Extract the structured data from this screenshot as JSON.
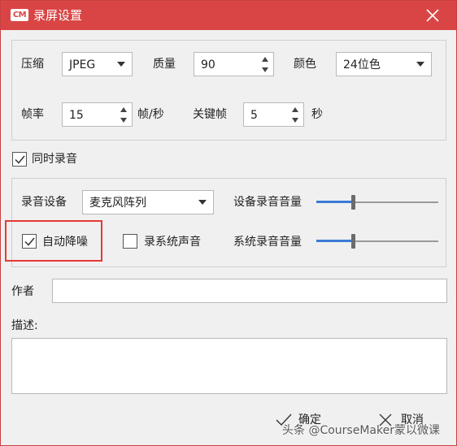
{
  "window": {
    "logo_text": "CM",
    "title": "录屏设置",
    "colors": {
      "titlebar": "#d94545",
      "highlight": "#e53935",
      "accent": "#3a7bd5"
    }
  },
  "video": {
    "compress_label": "压缩",
    "compress_value": "JPEG",
    "quality_label": "质量",
    "quality_value": "90",
    "color_label": "颜色",
    "color_value": "24位色",
    "framerate_label": "帧率",
    "framerate_value": "15",
    "framerate_unit": "帧/秒",
    "keyframe_label": "关键帧",
    "keyframe_value": "5",
    "keyframe_unit": "秒"
  },
  "audio": {
    "record_audio_label": "同时录音",
    "record_audio_checked": true,
    "device_label": "录音设备",
    "device_value": "麦克风阵列",
    "device_volume_label": "设备录音音量",
    "device_volume_level": 0.3,
    "denoise_label": "自动降噪",
    "denoise_checked": true,
    "system_audio_label": "录系统声音",
    "system_audio_checked": false,
    "system_volume_label": "系统录音音量",
    "system_volume_level": 0.3
  },
  "meta": {
    "author_label": "作者",
    "author_value": "",
    "desc_label": "描述:",
    "desc_value": ""
  },
  "actions": {
    "ok_label": "确定",
    "cancel_label": "取消"
  },
  "watermark": "头条 @CourseMaker蒙以微课"
}
